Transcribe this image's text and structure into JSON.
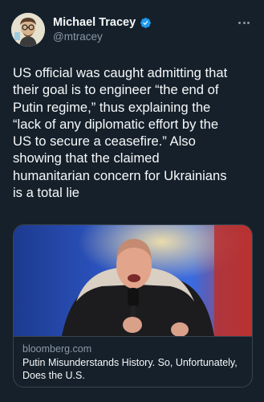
{
  "author": {
    "name": "Michael Tracey",
    "handle": "@mtracey",
    "verified": true
  },
  "tweet": {
    "text": "US official was caught admitting that\ntheir goal is to engineer “the end of\nPutin regime,” thus explaining the\n“lack of any diplomatic effort by the\nUS to secure a ceasefire.” Also\nshowing that the claimed\nhumanitarian concern for Ukrainians\nis a total lie"
  },
  "card": {
    "domain": "bloomberg.com",
    "title": "Putin Misunderstands History. So, Unfortunately, Does the U.S."
  },
  "icons": {
    "avatar": "cartoon-avatar",
    "verified": "verified-badge-icon",
    "more": "more-options-icon"
  },
  "colors": {
    "background": "#15202b",
    "text": "#f7f9f9",
    "secondary": "#8b98a5",
    "verified": "#1d9bf0",
    "border": "#38444d"
  }
}
